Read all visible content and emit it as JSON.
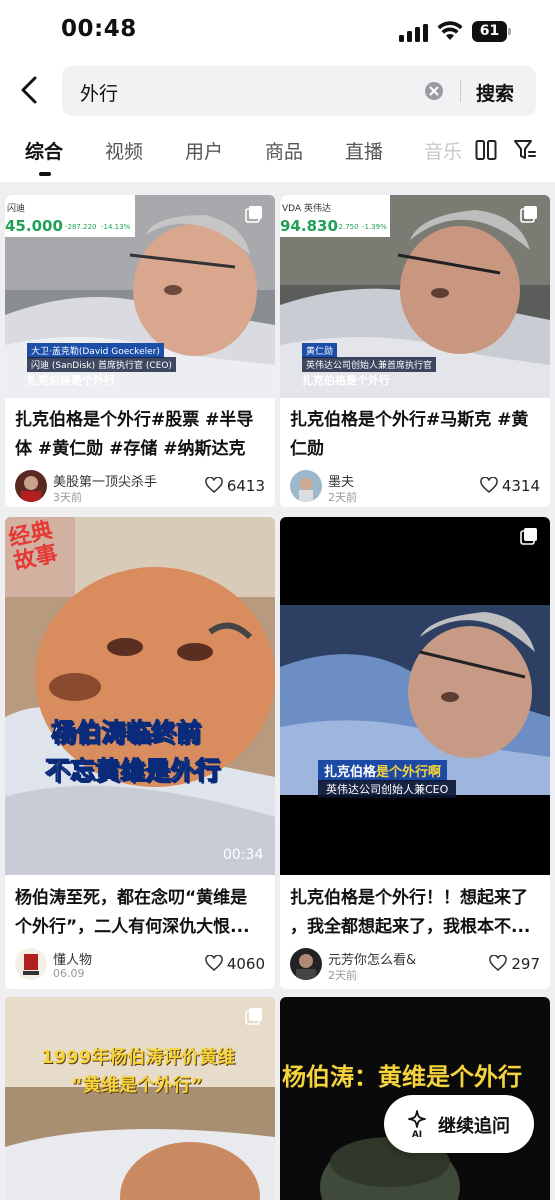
{
  "status_bar": {
    "time": "00:48",
    "battery": "61"
  },
  "search": {
    "value": "外行",
    "button_label": "搜索"
  },
  "tabs": [
    {
      "label": "综合",
      "active": true
    },
    {
      "label": "视频"
    },
    {
      "label": "用户"
    },
    {
      "label": "商品"
    },
    {
      "label": "直播"
    },
    {
      "label": "音乐"
    }
  ],
  "cards": [
    {
      "overlay": {
        "ticker_name": "闪迪",
        "ticker_price": "45.000",
        "ticker_change": "-287.220",
        "ticker_pct": "-14.13%",
        "name_caption": "大卫·盖克勒(David Goeckeler)",
        "role_caption": "闪迪 (SanDisk) 首席执行官 (CEO)",
        "subtitle": "扎克伯格是个外行"
      },
      "title_line1": "扎克伯格是个外行#股票 #半导",
      "title_line2": "体 #黄仁勋 #存储 #纳斯达克",
      "author": "美股第一顶尖杀手",
      "date": "3天前",
      "likes": "6413"
    },
    {
      "overlay": {
        "ticker_name": "VDA 英伟达",
        "ticker_price": "94.830",
        "ticker_change": "-2.750",
        "ticker_pct": "-1.39%",
        "name_caption": "黄仁勋",
        "role_caption": "英伟达公司创始人兼首席执行官",
        "subtitle": "扎克伯格是个外行"
      },
      "title_line1": "扎克伯格是个外行#马斯克 #黄",
      "title_line2": "仁勋",
      "author": "墨夫",
      "date": "2天前",
      "likes": "4314"
    },
    {
      "overlay": {
        "badge": "经典故事",
        "caption_line1": "杨伯涛临终前",
        "caption_line2": "不忘黄维是外行",
        "duration": "00:34"
      },
      "title_line1": "杨伯涛至死，都在念叨“黄维是",
      "title_line2": "个外行”，二人有何深仇大恨...",
      "author": "懂人物",
      "date": "06.09",
      "likes": "4060"
    },
    {
      "overlay": {
        "caption_name": "扎克伯格",
        "caption_highlight": "是个外行啊",
        "caption_role": "英伟达公司创始人兼CEO"
      },
      "title_line1": "扎克伯格是个外行！！想起来了",
      "title_line2": "，我全都想起来了，我根本不...",
      "author": "元芳你怎么看&",
      "date": "2天前",
      "likes": "297"
    },
    {
      "overlay": {
        "caption_line1": "1999年杨伯涛评价黄维",
        "caption_line2": "“黄维是个外行”"
      }
    },
    {
      "overlay": {
        "caption_line1": "杨伯涛：黄维是个外行"
      }
    }
  ],
  "ai_button": {
    "label": "继续追问",
    "icon_text": "AI"
  },
  "colors": {
    "accent_red": "#e53935",
    "caption_yellow": "#f5d33c",
    "ticker_green": "#22a05a"
  }
}
